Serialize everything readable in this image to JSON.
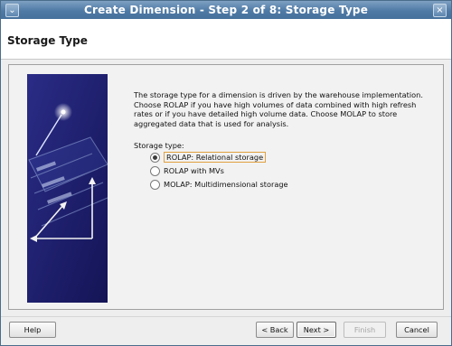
{
  "window": {
    "title": "Create Dimension - Step 2 of 8: Storage Type"
  },
  "header": {
    "title": "Storage Type"
  },
  "main": {
    "description": "The storage type for a dimension is driven by the warehouse implementation. Choose ROLAP if you have high volumes of data combined with high refresh rates or if you have detailed high volume data. Choose MOLAP to store aggregated data that is used for analysis.",
    "storage_label": "Storage type:",
    "options": [
      {
        "label": "ROLAP: Relational storage",
        "selected": true
      },
      {
        "label": "ROLAP with MVs",
        "selected": false
      },
      {
        "label": "MOLAP: Multidimensional storage",
        "selected": false
      }
    ]
  },
  "buttons": {
    "help": "Help",
    "back": "< Back",
    "next": "Next >",
    "finish": "Finish",
    "cancel": "Cancel"
  }
}
